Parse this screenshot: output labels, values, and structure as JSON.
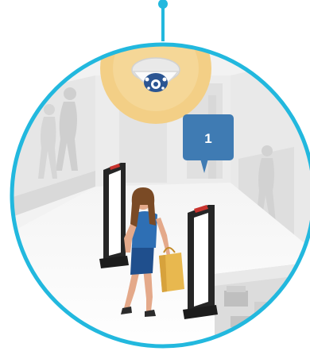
{
  "illustration": {
    "counter_badge": {
      "value": "1"
    },
    "camera": {
      "icon": "dome-camera-icon"
    },
    "gates": {
      "icon": "security-gate-icon"
    },
    "shopper": {
      "icon": "shopper-with-bag-icon"
    }
  },
  "colors": {
    "accent_ring": "#22b8de",
    "badge": "#3f7bb3",
    "camera_glow": "#f3cf86",
    "gate_dark": "#262626",
    "gate_led": "#c8332e",
    "bag": "#e8b84f",
    "shirt": "#2e6fb4",
    "hair": "#7a4a25"
  }
}
